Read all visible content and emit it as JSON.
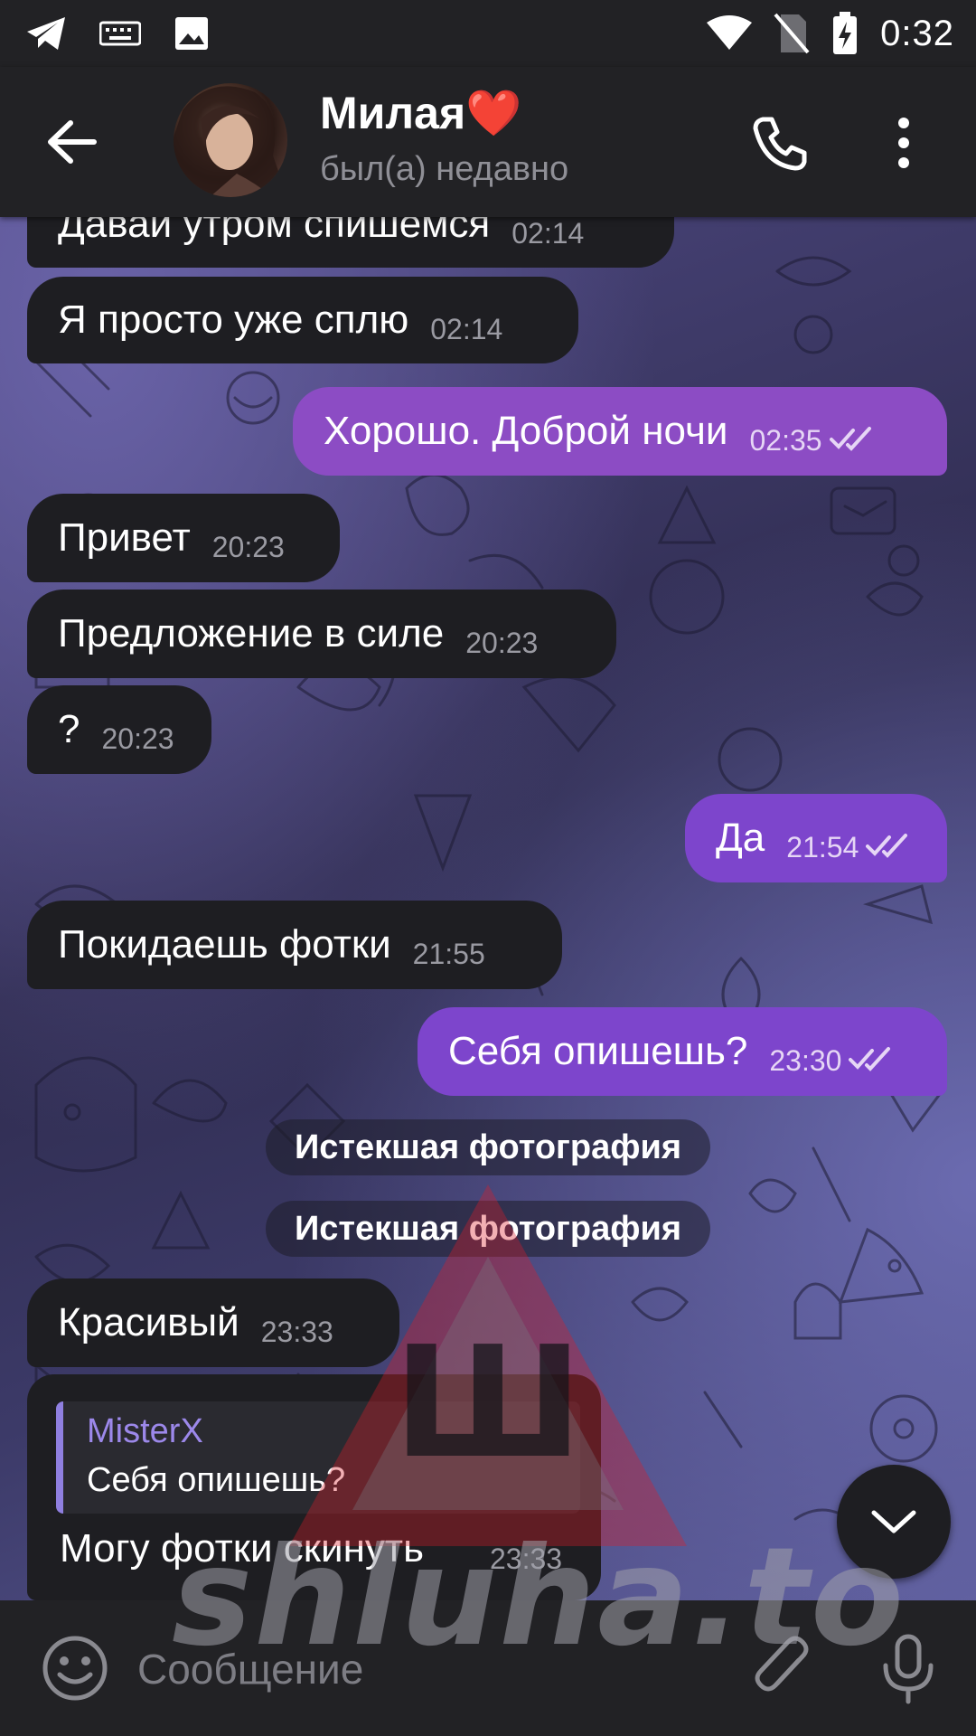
{
  "status_bar": {
    "time": "0:32"
  },
  "header": {
    "contact_name": "Милая",
    "heart": "❤️",
    "status": "был(а) недавно"
  },
  "messages": [
    {
      "text": "Давай утром спишемся",
      "time": "02:14",
      "direction": "in"
    },
    {
      "text": "Я просто уже сплю",
      "time": "02:14",
      "direction": "in"
    },
    {
      "text": "Хорошо. Доброй ночи",
      "time": "02:35",
      "direction": "out"
    },
    {
      "text": "Привет",
      "time": "20:23",
      "direction": "in"
    },
    {
      "text": "Предложение в силе",
      "time": "20:23",
      "direction": "in"
    },
    {
      "text": "?",
      "time": "20:23",
      "direction": "in"
    },
    {
      "text": "Да",
      "time": "21:54",
      "direction": "out"
    },
    {
      "text": "Покидаешь фотки",
      "time": "21:55",
      "direction": "in"
    },
    {
      "text": "Себя опишешь?",
      "time": "23:30",
      "direction": "out"
    },
    {
      "text": "Истекшая фотография",
      "type": "service"
    },
    {
      "text": "Истекшая фотография",
      "type": "service"
    },
    {
      "text": "Красивый",
      "time": "23:33",
      "direction": "in"
    },
    {
      "text": "Могу фотки скинуть",
      "time": "23:33",
      "direction": "in",
      "reply_to": {
        "name": "MisterX",
        "text": "Себя опишешь?"
      }
    }
  ],
  "input": {
    "placeholder": "Сообщение"
  },
  "watermark": {
    "text": "shluha.to",
    "glyph": "Ш"
  },
  "colors": {
    "outgoing": "#8c4cc4",
    "incoming": "#1e1e22",
    "accent_reply": "#9c88ea"
  },
  "icons": [
    "telegram-icon",
    "keyboard-icon",
    "image-icon",
    "wifi-icon",
    "no-sim-icon",
    "battery-charging-icon",
    "back-arrow-icon",
    "phone-icon",
    "more-vertical-icon",
    "double-check-icon",
    "chevron-down-icon",
    "emoji-icon",
    "attach-icon",
    "mic-icon"
  ]
}
